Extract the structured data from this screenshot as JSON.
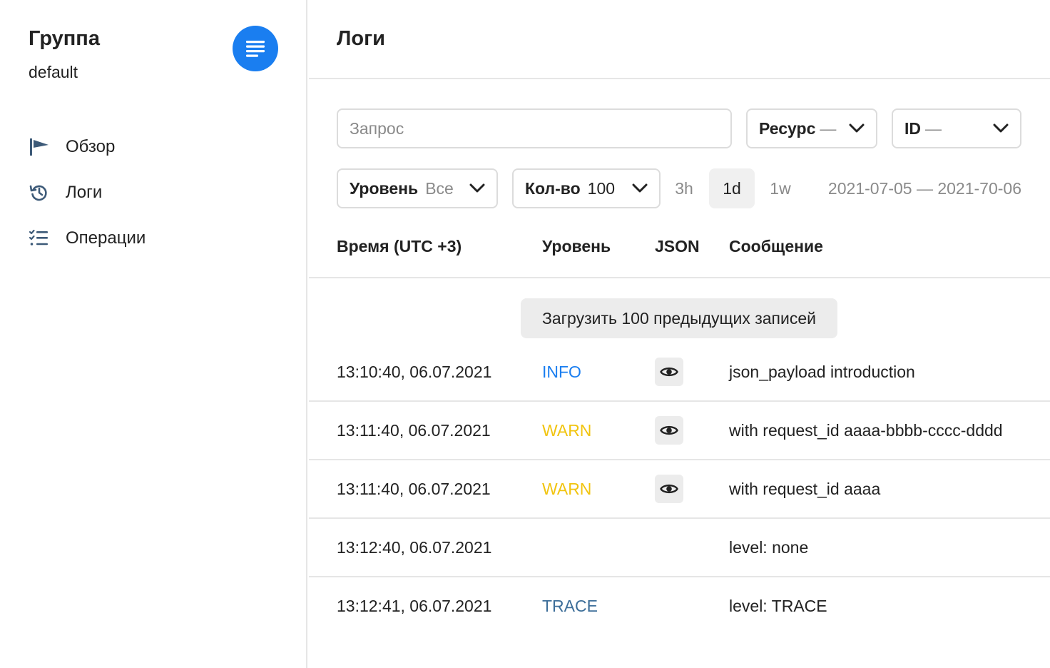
{
  "sidebar": {
    "group_title": "Группа",
    "group_name": "default",
    "menu_icon": "menu-lines-icon",
    "items": [
      {
        "label": "Обзор",
        "icon": "flag-icon"
      },
      {
        "label": "Логи",
        "icon": "history-icon"
      },
      {
        "label": "Операции",
        "icon": "checklist-icon"
      }
    ]
  },
  "main": {
    "title": "Логи",
    "filters": {
      "query_placeholder": "Запрос",
      "query_value": "",
      "resource": {
        "label": "Ресурс",
        "value": "—"
      },
      "id": {
        "label": "ID",
        "value": "—"
      },
      "level": {
        "label": "Уровень",
        "value": "Все"
      },
      "count": {
        "label": "Кол-во",
        "value": "100"
      },
      "ranges": [
        "3h",
        "1d",
        "1w"
      ],
      "active_range": "1d",
      "date_range": "2021-07-05 — 2021-70-06"
    },
    "table": {
      "headers": {
        "time": "Время (UTC +3)",
        "level": "Уровень",
        "json": "JSON",
        "message": "Сообщение"
      },
      "load_more_label": "Загрузить 100 предыдущих записей",
      "rows": [
        {
          "time": "13:10:40, 06.07.2021",
          "level": "INFO",
          "has_json": true,
          "message": "json_payload introduction"
        },
        {
          "time": "13:11:40, 06.07.2021",
          "level": "WARN",
          "has_json": true,
          "message": "with request_id aaaa-bbbb-cccc-dddd"
        },
        {
          "time": "13:11:40, 06.07.2021",
          "level": "WARN",
          "has_json": true,
          "message": "with request_id aaaa"
        },
        {
          "time": "13:12:40, 06.07.2021",
          "level": "",
          "has_json": false,
          "message": "level: none"
        },
        {
          "time": "13:12:41, 06.07.2021",
          "level": "TRACE",
          "has_json": false,
          "message": "level: TRACE"
        }
      ]
    }
  },
  "colors": {
    "accent": "#1a7ef0",
    "info": "#1a7ef0",
    "warn": "#f1c40f",
    "trace": "#3d6e99",
    "nav_icon": "#3d5a78"
  }
}
